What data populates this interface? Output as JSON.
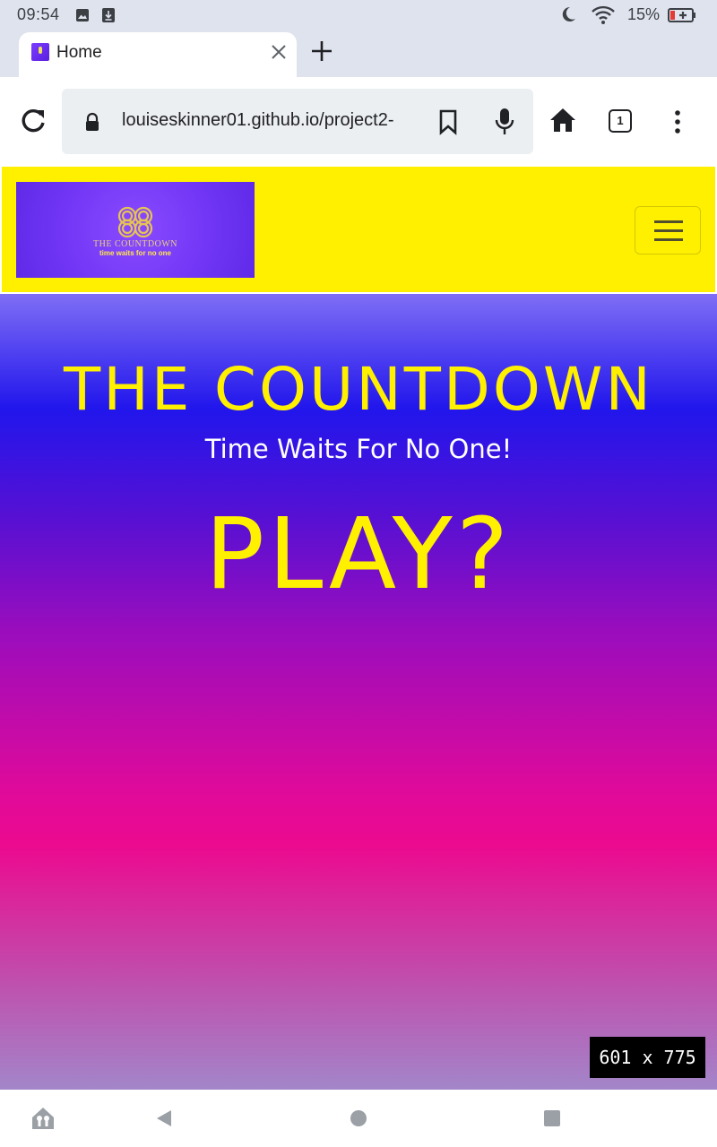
{
  "status_bar": {
    "time": "09:54",
    "battery_percent": "15%",
    "icons": [
      "image-icon",
      "download-icon",
      "moon-icon",
      "wifi-icon",
      "battery-icon"
    ]
  },
  "browser": {
    "tab": {
      "title": "Home"
    },
    "url": "louiseskinner01.github.io/project2-",
    "tab_count": "1"
  },
  "site": {
    "logo": {
      "title": "THE COUNTDOWN",
      "tagline": "time waits for no one"
    },
    "hero_title": "THE COUNTDOWN",
    "hero_subtitle": "Time Waits For No One!",
    "play_label": "PLAY?",
    "colors": {
      "navbar": "#fff000",
      "accent_text": "#fff000"
    }
  },
  "overlay": {
    "viewport_size": "601 x 775"
  },
  "android_nav": [
    "apps-icon",
    "back-icon",
    "home-circle-icon",
    "recents-icon"
  ]
}
